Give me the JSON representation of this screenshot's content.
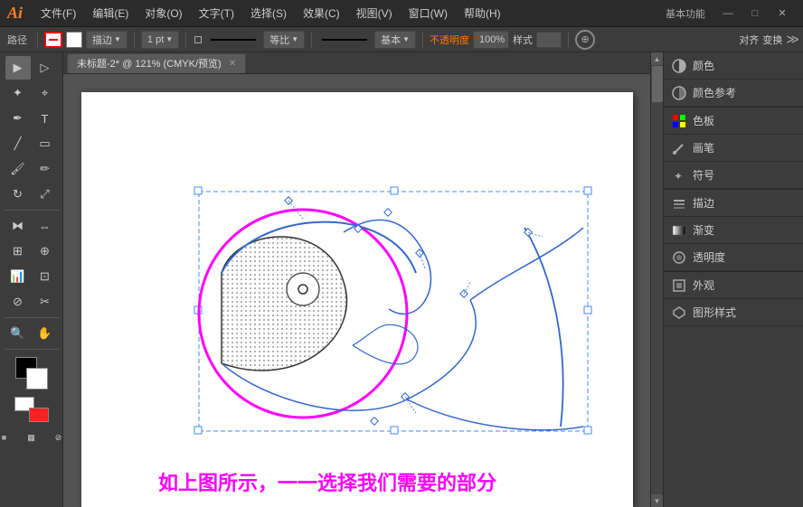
{
  "app": {
    "logo": "Ai",
    "title": "Adobe Illustrator"
  },
  "title_bar": {
    "menus": [
      "文件(F)",
      "编辑(E)",
      "对象(O)",
      "文字(T)",
      "选择(S)",
      "效果(C)",
      "视图(V)",
      "窗口(W)",
      "帮助(H)"
    ],
    "profile": "基本功能",
    "win_minimize": "—",
    "win_restore": "□",
    "win_close": "✕"
  },
  "toolbar": {
    "path_label": "路径",
    "stroke_size": "1 pt",
    "equal_label": "等比",
    "basic_label": "基本",
    "opacity_label": "不透明度",
    "style_label": "样式",
    "align_label": "对齐",
    "transform_label": "变换"
  },
  "tab": {
    "title": "未标题-2* @ 121% (CMYK/预览)",
    "close": "✕"
  },
  "caption": {
    "text": "如上图所示，一一选择我们需要的部分"
  },
  "right_panel": {
    "items": [
      {
        "icon": "color",
        "label": "颜色",
        "symbol": "◑"
      },
      {
        "icon": "color-ref",
        "label": "颜色参考",
        "symbol": "◑"
      },
      {
        "icon": "swatches",
        "label": "色板",
        "symbol": "▦"
      },
      {
        "icon": "brush",
        "label": "画笔",
        "symbol": "✏"
      },
      {
        "icon": "symbols",
        "label": "符号",
        "symbol": "✦"
      },
      {
        "icon": "stroke",
        "label": "描边",
        "symbol": "≡"
      },
      {
        "icon": "gradient",
        "label": "渐变",
        "symbol": "▤"
      },
      {
        "icon": "transparency",
        "label": "透明度",
        "symbol": "◎"
      },
      {
        "icon": "appearance",
        "label": "外观",
        "symbol": "◈"
      },
      {
        "icon": "graphic-styles",
        "label": "图形样式",
        "symbol": "⬡"
      }
    ]
  }
}
